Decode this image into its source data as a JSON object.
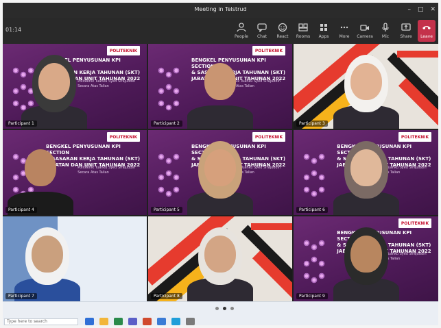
{
  "window": {
    "title": "Meeting in Telstrud"
  },
  "toolbar": {
    "timer": "01:14",
    "buttons": [
      {
        "label": "People",
        "icon": "people-icon"
      },
      {
        "label": "Chat",
        "icon": "chat-icon"
      },
      {
        "label": "React",
        "icon": "react-icon"
      },
      {
        "label": "Rooms",
        "icon": "rooms-icon"
      },
      {
        "label": "Apps",
        "icon": "apps-icon"
      },
      {
        "label": "More",
        "icon": "more-icon"
      },
      {
        "label": "Camera",
        "icon": "camera-icon"
      },
      {
        "label": "Mic",
        "icon": "mic-icon"
      },
      {
        "label": "Share",
        "icon": "share-icon"
      },
      {
        "label": "Leave",
        "icon": "leave-icon"
      }
    ]
  },
  "slide_text": {
    "logo": "POLITEKNIK",
    "headline": "BENGKEL PENYUSUNAN KPI SECTION\n& SASARAN KERJA TAHUNAN (SKT)\nJABATAN DAN UNIT TAHUNAN 2022",
    "sub": "Politeknik Tuanku Syed Sirajuddin\nSecara Atas Talian"
  },
  "tiles": [
    {
      "name": "Participant 1",
      "kind": "slide"
    },
    {
      "name": "Participant 2",
      "kind": "slide"
    },
    {
      "name": "Participant 3",
      "kind": "mosaic"
    },
    {
      "name": "Participant 4",
      "kind": "slide"
    },
    {
      "name": "Participant 5",
      "kind": "slide"
    },
    {
      "name": "Participant 6",
      "kind": "slide"
    },
    {
      "name": "Participant 7",
      "kind": "room"
    },
    {
      "name": "Participant 8",
      "kind": "mosaic"
    },
    {
      "name": "Participant 9",
      "kind": "slide"
    }
  ],
  "taskbar": {
    "search_placeholder": "Type here to search"
  },
  "colors": {
    "slide_purple": "#5a1f5e",
    "leave_red": "#c4314b",
    "taskbar": "#eaeef4"
  }
}
